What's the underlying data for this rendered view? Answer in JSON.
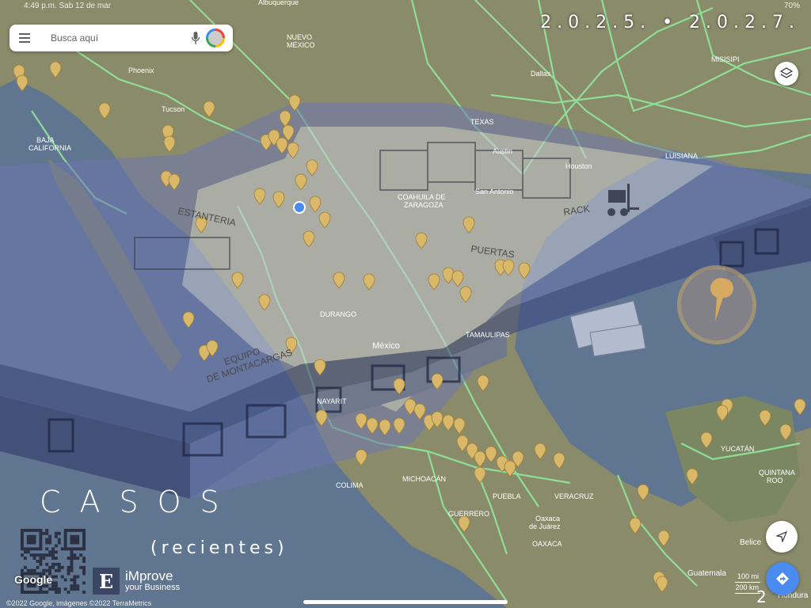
{
  "status_bar": {
    "left": "4:49 p.m.  Sab 12 de mar",
    "right": "70%"
  },
  "years_banner": "2.0.2.5.  •  2.0.2.7.",
  "search": {
    "placeholder": "Busca aquí"
  },
  "map_labels": {
    "albuquerque": "Albuquerque",
    "nuevo_mexico": "NUEVO\nMÉXICO",
    "phoenix": "Phoenix",
    "tucson": "Tucson",
    "baja_california": "BAJA\nCALIFORNIA",
    "texas": "TEXAS",
    "dallas": "Dallas",
    "misisipi": "MISISIPI",
    "luisiana": "LUISIANA",
    "austin": "Austin",
    "houston": "Houston",
    "san_antonio": "San Antonio",
    "coahuila": "COAHUILA DE\nZARAGOZA",
    "durango": "DURANGO",
    "tamaulipas": "TAMAULIPAS",
    "mexico": "México",
    "nayarit": "NAYARIT",
    "colima": "COLIMA",
    "michoacan": "MICHOACÁN",
    "guerrero": "GUERRERO",
    "puebla": "PUEBLA",
    "veracruz": "VERACRUZ",
    "oaxaca_de_juarez": "Oaxaca\nde Juárez",
    "oaxaca": "OAXACA",
    "yucatan": "YUCATÁN",
    "quintana_roo": "QUINTANA\nROO",
    "belice": "Belice",
    "guatemala": "Guatemala",
    "honduras": "Hondura"
  },
  "warehouse_labels": {
    "estanteria": "ESTANTERIA",
    "rack": "RACK",
    "puertas": "PUERTAS",
    "equipo": "EQUIPO\nDE MONTACARGAS"
  },
  "casos_title": "CASOS",
  "recientes_subtitle": "(recientes)",
  "brand": {
    "name": "iMprove",
    "tagline": "your Business",
    "letter": "E"
  },
  "google_logo": "Google",
  "copyright": "©2022 Google, imágenes ©2022 TerraMetrics",
  "scale": {
    "top": "100 mi",
    "bottom": "200 km"
  },
  "zoom_digit": "2",
  "colors": {
    "ocean": "#5f7590",
    "land": "#8a8b6b",
    "roads": "#8fe89a",
    "overlay_blue": "#5a6aa8",
    "pin": "#d9b86a",
    "location_dot": "#4a8bf0"
  },
  "icons": [
    "menu-icon",
    "mic-icon",
    "layers-icon",
    "compass-icon",
    "directions-icon",
    "location-pin-icon",
    "forklift-icon"
  ]
}
